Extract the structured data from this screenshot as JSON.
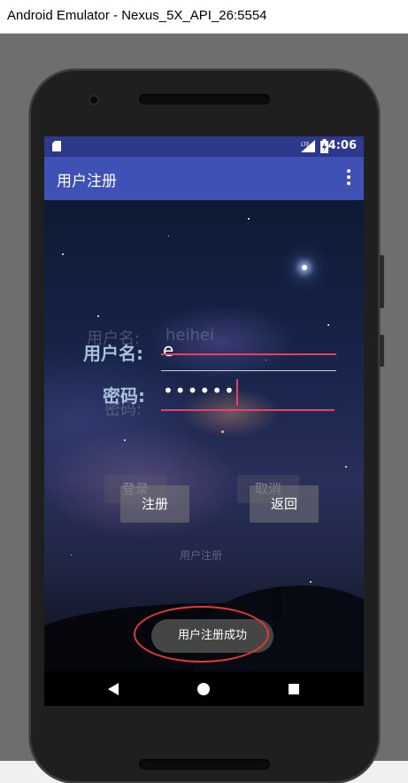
{
  "window": {
    "title": "Android Emulator - Nexus_5X_API_26:5554"
  },
  "statusbar": {
    "network": "LTE",
    "time": "4:06"
  },
  "appbar": {
    "title": "用户注册"
  },
  "form": {
    "username_label": "用户名:",
    "username_value": "e",
    "password_label": "密码:",
    "password_value": "••••••"
  },
  "ghost": {
    "username_label": "用户名:",
    "username_value": "heihei",
    "password_label": "密码:",
    "login_button": "登录",
    "cancel_button": "取消",
    "register_text": "用户注册"
  },
  "buttons": {
    "register": "注册",
    "back": "返回"
  },
  "toast": {
    "message": "用户注册成功"
  }
}
